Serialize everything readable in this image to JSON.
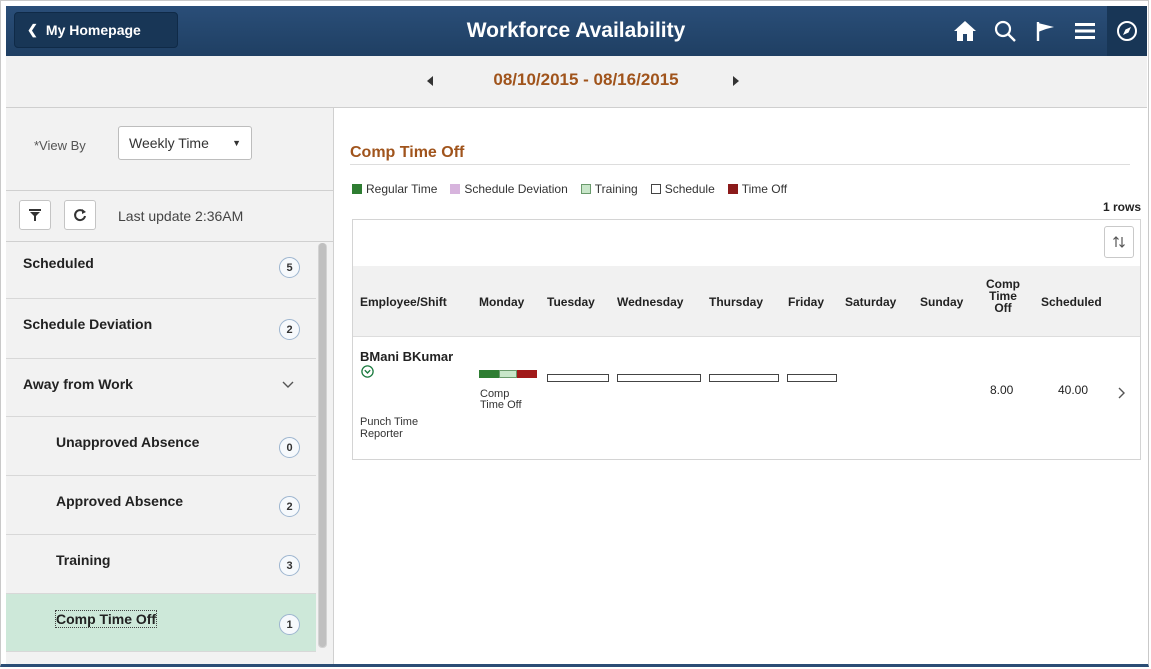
{
  "header": {
    "home_label": "My Homepage",
    "title": "Workforce Availability",
    "icons": [
      "home-icon",
      "search-icon",
      "flag-icon",
      "menu-icon",
      "compass-icon"
    ],
    "bg_color": "#24466c"
  },
  "date_range": "08/10/2015 - 08/16/2015",
  "filters": {
    "view_by_label": "*View By",
    "view_by_value": "Weekly Time",
    "last_update": "Last update 2:36AM"
  },
  "nav": {
    "items": [
      {
        "label": "Scheduled",
        "count": "5"
      },
      {
        "label": "Schedule Deviation",
        "count": "2"
      },
      {
        "label": "Away from Work"
      },
      {
        "label": "Unapproved Absence",
        "count": "0"
      },
      {
        "label": "Approved Absence",
        "count": "2"
      },
      {
        "label": "Training",
        "count": "3"
      },
      {
        "label": "Comp Time Off",
        "count": "1"
      }
    ],
    "active_color": "#cde8d9"
  },
  "main": {
    "section_title": "Comp Time Off",
    "legend": [
      {
        "label": "Regular Time",
        "color": "#2e7d32"
      },
      {
        "label": "Schedule Deviation",
        "color": "#d7b4dd"
      },
      {
        "label": "Training",
        "color": "#c8e6c9"
      },
      {
        "label": "Schedule",
        "color": "#ffffff"
      },
      {
        "label": "Time Off",
        "color": "#8b1a1a"
      }
    ],
    "row_count": "1 rows",
    "columns": {
      "employee": "Employee/Shift",
      "mon": "Monday",
      "tue": "Tuesday",
      "wed": "Wednesday",
      "thu": "Thursday",
      "fri": "Friday",
      "sat": "Saturday",
      "sun": "Sunday",
      "comp_1": "Comp",
      "comp_2": "Time",
      "comp_3": "Off",
      "scheduled": "Scheduled"
    },
    "rows": [
      {
        "employee": "BMani BKumar",
        "role_1": "Punch Time",
        "role_2": "Reporter",
        "monday_label_1": "Comp",
        "monday_label_2": "Time Off",
        "comp_time_off": "8.00",
        "scheduled": "40.00"
      }
    ]
  }
}
